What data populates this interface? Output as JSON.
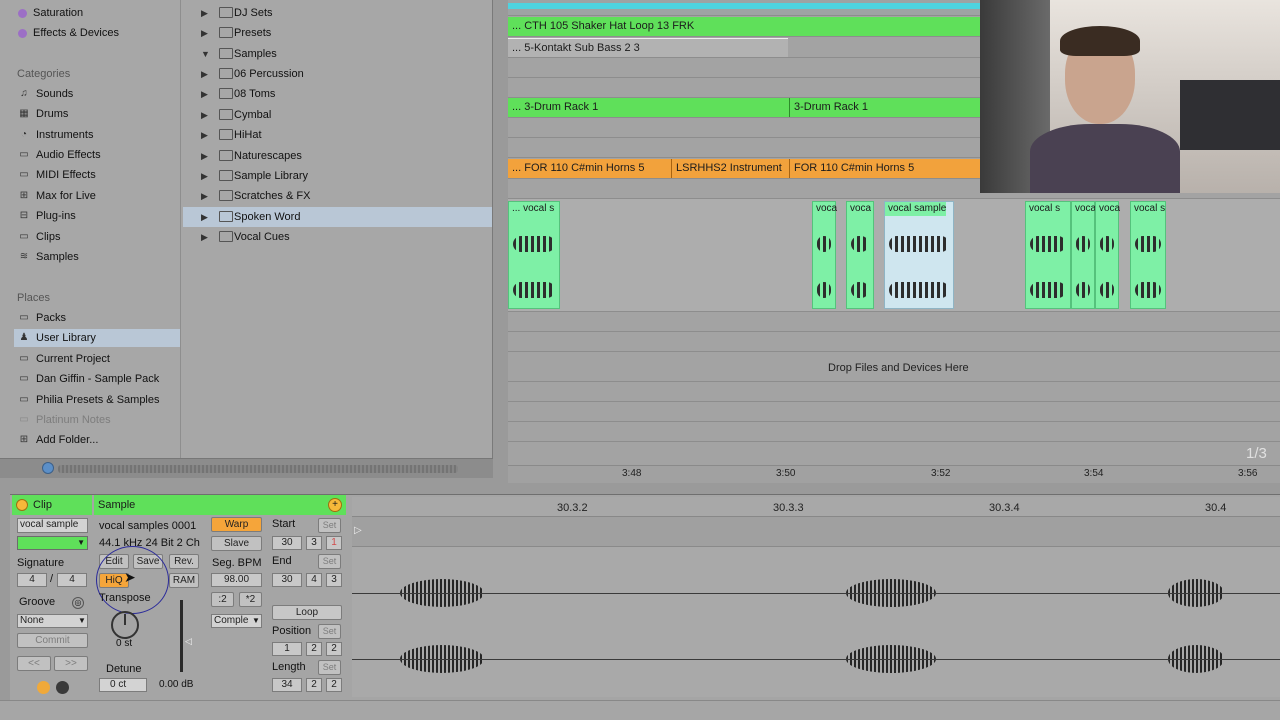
{
  "browser": {
    "left_items_top": [
      {
        "label": "Saturation",
        "icon": "dot-icon"
      },
      {
        "label": "Effects & Devices",
        "icon": "dot-icon"
      }
    ],
    "categories_header": "Categories",
    "categories": [
      {
        "label": "Sounds",
        "icon": "sounds-icon"
      },
      {
        "label": "Drums",
        "icon": "drums-icon"
      },
      {
        "label": "Instruments",
        "icon": "instruments-icon"
      },
      {
        "label": "Audio Effects",
        "icon": "audio-effects-icon"
      },
      {
        "label": "MIDI Effects",
        "icon": "midi-effects-icon"
      },
      {
        "label": "Max for Live",
        "icon": "max-icon"
      },
      {
        "label": "Plug-ins",
        "icon": "plugins-icon"
      },
      {
        "label": "Clips",
        "icon": "clips-icon"
      },
      {
        "label": "Samples",
        "icon": "samples-icon"
      }
    ],
    "places_header": "Places",
    "places": [
      {
        "label": "Packs"
      },
      {
        "label": "User Library"
      },
      {
        "label": "Current Project"
      },
      {
        "label": "Dan Giffin - Sample Pack"
      },
      {
        "label": "Philia Presets & Samples"
      },
      {
        "label": "Platinum Notes"
      },
      {
        "label": "Add Folder..."
      }
    ],
    "folders": [
      {
        "label": "DJ Sets",
        "indent": 0,
        "open": false
      },
      {
        "label": "Presets",
        "indent": 0,
        "open": false
      },
      {
        "label": "Samples",
        "indent": 0,
        "open": true
      },
      {
        "label": "06 Percussion",
        "indent": 1,
        "open": false
      },
      {
        "label": "08 Toms",
        "indent": 1,
        "open": false
      },
      {
        "label": "Cymbal",
        "indent": 1,
        "open": false
      },
      {
        "label": "HiHat",
        "indent": 1,
        "open": false
      },
      {
        "label": "Naturescapes",
        "indent": 1,
        "open": false
      },
      {
        "label": "Sample Library",
        "indent": 1,
        "open": false
      },
      {
        "label": "Scratches & FX",
        "indent": 1,
        "open": false
      },
      {
        "label": "Spoken Word",
        "indent": 1,
        "open": false
      },
      {
        "label": "Vocal Cues",
        "indent": 1,
        "open": false
      }
    ]
  },
  "arrangement": {
    "clips": {
      "shaker": "... CTH  105  Shaker     Hat  Loop  13  FRK",
      "sub_bass": "... 5-Kontakt Sub Bass 2 3",
      "drum_rack_1": "... 3-Drum Rack 1",
      "drum_rack_2": "3-Drum Rack 1",
      "horns_1": "... FOR  110  C#min  Horns  5",
      "lsrhhs": "LSRHHS2  Instrument",
      "horns_2": "FOR  110  C#min  Horns  5",
      "vocal_1": "... vocal s",
      "vocal_2": "voca",
      "vocal_3": "voca",
      "vocal_4": "vocal sample",
      "vocal_5": "vocal s",
      "vocal_6": "voca",
      "vocal_7": "voca",
      "vocal_8": "vocal s"
    },
    "drop_text": "Drop Files and Devices Here",
    "page_indicator": "1/3",
    "ruler": [
      "3:48",
      "3:50",
      "3:52",
      "3:54",
      "3:56"
    ]
  },
  "detail": {
    "clip_header": "Clip",
    "clip_name": "vocal sample",
    "signature_label": "Signature",
    "sig_num": "4",
    "sig_den": "4",
    "groove_label": "Groove",
    "groove_value": "None",
    "commit_label": "Commit",
    "sample_header": "Sample",
    "sample_name": "vocal samples 0001",
    "sample_info": "44.1 kHz 24 Bit 2 Ch",
    "edit": "Edit",
    "save": "Save",
    "rev": "Rev.",
    "hiq": "HiQ",
    "ram": "RAM",
    "transpose_label": "Transpose",
    "transpose_value": "0 st",
    "detune_label": "Detune",
    "detune_value": "0 ct",
    "gain_value": "0.00 dB",
    "warp": "Warp",
    "slave": "Slave",
    "seg_bpm_label": "Seg. BPM",
    "seg_bpm_value": "98.00",
    "half": ":2",
    "double": "*2",
    "warp_mode": "Comple",
    "start_label": "Start",
    "start_vals": [
      "30",
      "3",
      "1"
    ],
    "end_label": "End",
    "end_vals": [
      "30",
      "4",
      "3"
    ],
    "loop": "Loop",
    "position_label": "Position",
    "position_vals": [
      "1",
      "2",
      "2"
    ],
    "length_label": "Length",
    "length_vals": [
      "34",
      "2",
      "2"
    ],
    "set": "Set",
    "timeline": [
      "30.3.2",
      "30.3.3",
      "30.3.4",
      "30.4"
    ]
  },
  "colors": {
    "clip_green": "#5fe05a",
    "clip_orange": "#f2a23c",
    "audio_clip": "#7ef0a6",
    "selected_row": "#b9c7d6"
  }
}
